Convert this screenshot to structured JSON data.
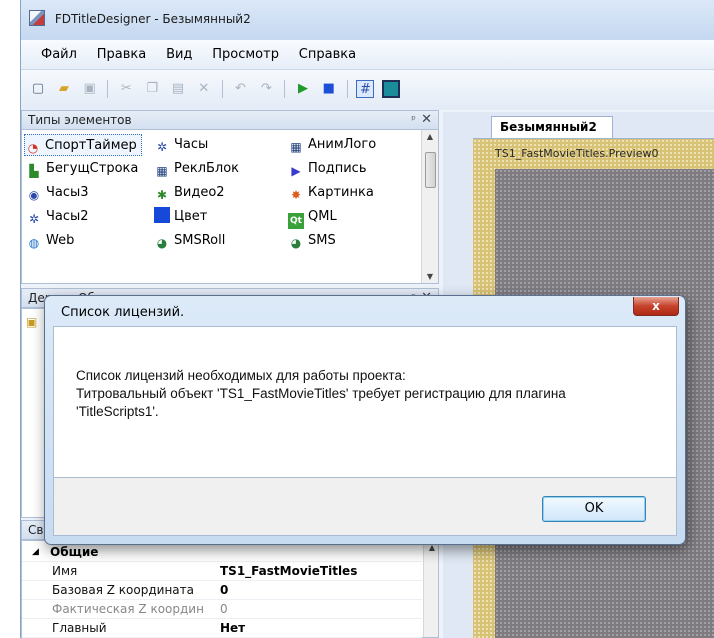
{
  "window": {
    "title": "FDTitleDesigner - Безымянный2",
    "icon": "app-icon"
  },
  "menu": [
    "Файл",
    "Правка",
    "Вид",
    "Просмотр",
    "Справка"
  ],
  "toolbar": {
    "icons": [
      "new-icon",
      "open-icon",
      "save-icon",
      "cut-icon",
      "copy-icon",
      "paste-icon",
      "delete-icon",
      "undo-icon",
      "redo-icon",
      "play-icon",
      "stop-icon",
      "grid-icon",
      "frame-icon"
    ]
  },
  "elements_panel": {
    "title": "Типы элементов",
    "items": [
      {
        "label": "СпортТаймер",
        "icon": "stopwatch-icon",
        "color": "#d4321c"
      },
      {
        "label": "Часы",
        "icon": "clock-icon",
        "color": "#2a4aa8"
      },
      {
        "label": "АнимЛого",
        "icon": "film-icon",
        "color": "#1b3b7a"
      },
      {
        "label": "БегущСтрока",
        "icon": "ticker-icon",
        "color": "#2c8a2c"
      },
      {
        "label": "РеклБлок",
        "icon": "film-icon",
        "color": "#1b3b7a"
      },
      {
        "label": "Подпись",
        "icon": "caption-icon",
        "color": "#3a3ad0"
      },
      {
        "label": "Часы3",
        "icon": "clock-icon",
        "color": "#2a4aa8"
      },
      {
        "label": "Видео2",
        "icon": "video-icon",
        "color": "#2c8a2c"
      },
      {
        "label": "Картинка",
        "icon": "picture-icon",
        "color": "#e05a1e"
      },
      {
        "label": "Часы2",
        "icon": "clock-icon",
        "color": "#2a4aa8"
      },
      {
        "label": "Цвет",
        "icon": "color-icon",
        "color": "#1749d8"
      },
      {
        "label": "QML",
        "icon": "qml-icon",
        "color": "#3aa13a"
      },
      {
        "label": "Web",
        "icon": "web-icon",
        "color": "#1b6fc6"
      },
      {
        "label": "SMSRoll",
        "icon": "sms-icon",
        "color": "#2a7d3a"
      },
      {
        "label": "SMS",
        "icon": "sms-icon",
        "color": "#2a7d3a"
      }
    ]
  },
  "tree_panel": {
    "title": "Дерево Объектов"
  },
  "properties": {
    "title": "Свойства",
    "group": "Общие",
    "rows": [
      {
        "name": "Имя",
        "value": "TS1_FastMovieTitles",
        "dim": false
      },
      {
        "name": "Базовая Z координата",
        "value": "0",
        "dim": false
      },
      {
        "name": "Фактическая Z координ",
        "value": "0",
        "dim": true
      },
      {
        "name": "Главный",
        "value": "Нет",
        "dim": false
      }
    ]
  },
  "document": {
    "tab": "Безымянный2",
    "preview_label": "TS1_FastMovieTitles.Preview0"
  },
  "dialog": {
    "title": "Список лицензий.",
    "line1": "Список лицензий необходимых для работы проекта:",
    "line2": "Титровальный объект 'TS1_FastMovieTitles' требует регистрацию для плагина",
    "line3": "'TitleScripts1'.",
    "ok": "OK",
    "close": "x"
  }
}
